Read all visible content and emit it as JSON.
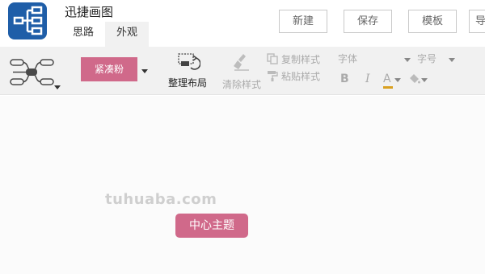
{
  "app": {
    "title": "迅捷画图",
    "logo_icon": "mindmap-logo-icon",
    "brand_color": "#1f5ea8"
  },
  "tabs": [
    {
      "label": "思路"
    },
    {
      "label": "外观"
    }
  ],
  "actions": {
    "new_label": "新建",
    "save_label": "保存",
    "template_label": "模板",
    "more_label": "导"
  },
  "ribbon": {
    "structure_icon": "structure-layout-icon",
    "theme_label": "紧凑粉",
    "theme_color": "#d0698a",
    "layout_label": "整理布局",
    "clear_style_label": "清除样式",
    "copy_style_label": "复制样式",
    "paste_style_label": "粘贴样式",
    "font_placeholder": "字体",
    "size_placeholder": "字号",
    "bold_label": "B",
    "italic_label": "I",
    "font_color_label": "A",
    "font_color": "#d9a020"
  },
  "canvas": {
    "watermark": "tuhuaba.com",
    "central_topic": "中心主题",
    "topic_color": "#d0698a"
  }
}
